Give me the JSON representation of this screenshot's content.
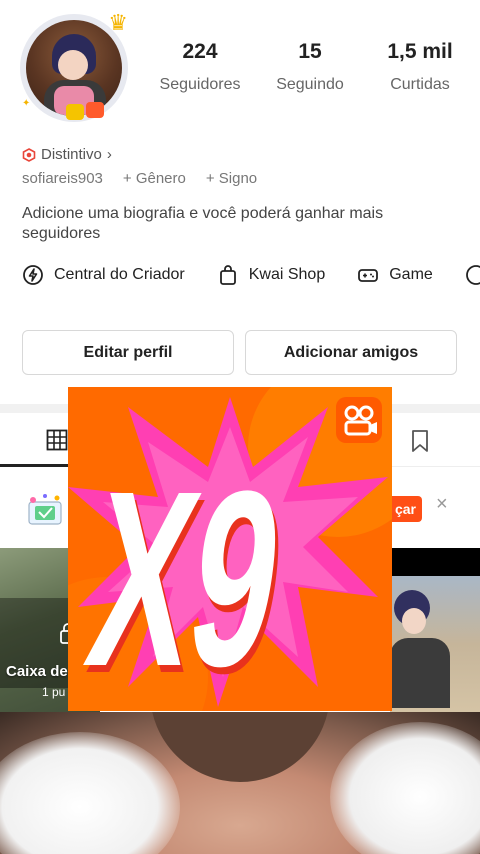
{
  "profile": {
    "avatar_icon": "profile-avatar",
    "stats": [
      {
        "value": "224",
        "label": "Seguidores"
      },
      {
        "value": "15",
        "label": "Seguindo"
      },
      {
        "value": "1,5 mil",
        "label": "Curtidas"
      }
    ],
    "badge_label": "Distintivo",
    "username": "sofiareis903",
    "gender_label": "+ Gênero",
    "sign_label": "+ Signo",
    "bio": "Adicione uma biografia e você poderá ganhar mais seguidores"
  },
  "links": [
    {
      "label": "Central do Criador",
      "icon": "creator-center-icon"
    },
    {
      "label": "Kwai Shop",
      "icon": "shopping-bag-icon"
    },
    {
      "label": "Game",
      "icon": "gamepad-icon"
    }
  ],
  "buttons": {
    "edit": "Editar perfil",
    "add_friends": "Adicionar amigos"
  },
  "tabs": {
    "grid_icon": "grid-icon",
    "bookmark_icon": "bookmark-icon"
  },
  "banner": {
    "cta_partial": "çar",
    "close_icon": "close-icon"
  },
  "videos": {
    "left_title_partial": "Caixa de",
    "left_sub_partial": "1 pu"
  },
  "overlay": {
    "text": "X9",
    "logo_icon": "kwai-logo-icon"
  },
  "colors": {
    "accent": "#ff4f16",
    "overlay_orange": "#ff6a00",
    "overlay_pink": "#ff3fb3"
  }
}
